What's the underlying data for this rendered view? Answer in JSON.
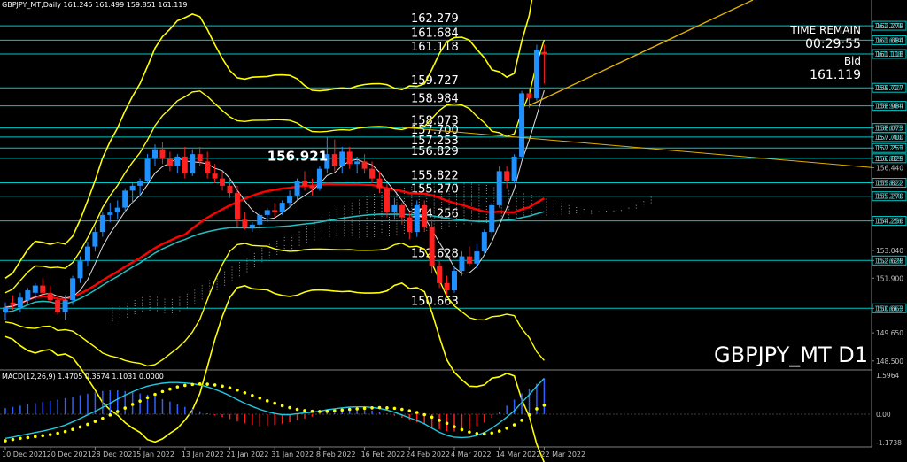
{
  "header": {
    "title": "GBPJPY_MT,Daily  161.245 161.499 159.851 161.119"
  },
  "watermark": "GBPJPY_MT D1",
  "info": {
    "time_remain_label": "TIME REMAIN",
    "time_remain": "00:29:55",
    "bid_label": "Bid",
    "bid": "161.119"
  },
  "macd": {
    "label": "MACD(12,26,9) 1.4705 0.3674 1.1031 0.0000",
    "ticks": [
      "1.5964",
      "0.00",
      "-1.1738"
    ],
    "range": [
      -1.1738,
      1.5964
    ]
  },
  "colors": {
    "background": "#000000",
    "grid": "#1e1e1e",
    "level_line": "#00c8c8",
    "bull": "#1e90ff",
    "bear": "#ff2020",
    "bollinger": "#ffff00",
    "ma_red": "#ff0000",
    "ma_cyan": "#20c0c0",
    "ma_white": "#e0e0e0",
    "trendline": "#e0b000",
    "macd_hist_pos": "#3060ff",
    "macd_hist_neg": "#ff2020",
    "macd_main": "#20c8e0",
    "macd_signal": "#ffff00",
    "axis_text": "#c0c0c0",
    "level_label": "#ffffff"
  },
  "chart_data": {
    "type": "candlestick",
    "symbol": "GBPJPY_MT",
    "timeframe": "Daily",
    "ylim": [
      148.2,
      162.9
    ],
    "y_ticks": [
      "162.279",
      "161.684",
      "161.118",
      "159.727",
      "158.984",
      "158.073",
      "157.700",
      "157.253",
      "156.829",
      "156.440",
      "155.822",
      "155.270",
      "154.256",
      "153.040",
      "152.628",
      "151.900",
      "150.663",
      "149.650",
      "148.500"
    ],
    "x_ticks": [
      "10 Dec 2021",
      "20 Dec 2021",
      "28 Dec 2021",
      "5 Jan 2022",
      "13 Jan 2022",
      "21 Jan 2022",
      "31 Jan 2022",
      "8 Feb 2022",
      "16 Feb 2022",
      "24 Feb 2022",
      "4 Mar 2022",
      "14 Mar 2022",
      "22 Mar 2022"
    ],
    "levels": [
      {
        "label": "162.279",
        "value": 162.279
      },
      {
        "label": "161.684",
        "value": 161.684
      },
      {
        "label": "161.118",
        "value": 161.118
      },
      {
        "label": "159.727",
        "value": 159.727
      },
      {
        "label": "158.984",
        "value": 158.984
      },
      {
        "label": "158.073",
        "value": 158.073
      },
      {
        "label": "157.700",
        "value": 157.7
      },
      {
        "label": "157.253",
        "value": 157.253
      },
      {
        "label": "156.829",
        "value": 156.829
      },
      {
        "label": "155.822",
        "value": 155.822
      },
      {
        "label": "155.270",
        "value": 155.27
      },
      {
        "label": "154.256",
        "value": 154.256
      },
      {
        "label": "152.628",
        "value": 152.628
      },
      {
        "label": "150.663",
        "value": 150.663
      }
    ],
    "annotation": {
      "label": "156.921",
      "value": 156.921,
      "bar": 35
    },
    "candles": [
      {
        "o": 150.5,
        "h": 150.9,
        "l": 150.2,
        "c": 150.7
      },
      {
        "o": 150.9,
        "h": 151.2,
        "l": 150.6,
        "c": 150.8
      },
      {
        "o": 150.7,
        "h": 151.3,
        "l": 150.5,
        "c": 151.1
      },
      {
        "o": 151.0,
        "h": 151.5,
        "l": 150.8,
        "c": 151.4
      },
      {
        "o": 151.3,
        "h": 151.7,
        "l": 151.0,
        "c": 151.6
      },
      {
        "o": 151.6,
        "h": 151.9,
        "l": 151.2,
        "c": 151.3
      },
      {
        "o": 151.3,
        "h": 151.6,
        "l": 150.9,
        "c": 151.0
      },
      {
        "o": 151.0,
        "h": 151.2,
        "l": 150.4,
        "c": 150.5
      },
      {
        "o": 150.5,
        "h": 151.2,
        "l": 150.2,
        "c": 151.0
      },
      {
        "o": 151.0,
        "h": 152.0,
        "l": 150.8,
        "c": 151.9
      },
      {
        "o": 151.9,
        "h": 152.8,
        "l": 151.7,
        "c": 152.6
      },
      {
        "o": 152.6,
        "h": 153.4,
        "l": 152.4,
        "c": 153.2
      },
      {
        "o": 153.2,
        "h": 154.0,
        "l": 153.0,
        "c": 153.8
      },
      {
        "o": 153.8,
        "h": 154.6,
        "l": 153.6,
        "c": 154.5
      },
      {
        "o": 154.5,
        "h": 155.0,
        "l": 154.2,
        "c": 154.6
      },
      {
        "o": 154.6,
        "h": 155.1,
        "l": 154.3,
        "c": 154.8
      },
      {
        "o": 154.8,
        "h": 155.6,
        "l": 154.6,
        "c": 155.5
      },
      {
        "o": 155.5,
        "h": 155.8,
        "l": 155.0,
        "c": 155.7
      },
      {
        "o": 155.7,
        "h": 156.0,
        "l": 155.3,
        "c": 155.9
      },
      {
        "o": 155.9,
        "h": 157.0,
        "l": 155.8,
        "c": 156.8
      },
      {
        "o": 156.8,
        "h": 157.4,
        "l": 156.5,
        "c": 157.2
      },
      {
        "o": 157.2,
        "h": 157.5,
        "l": 156.6,
        "c": 156.8
      },
      {
        "o": 156.8,
        "h": 157.1,
        "l": 156.3,
        "c": 156.5
      },
      {
        "o": 156.5,
        "h": 157.0,
        "l": 156.2,
        "c": 156.9
      },
      {
        "o": 156.9,
        "h": 157.3,
        "l": 156.0,
        "c": 156.2
      },
      {
        "o": 156.2,
        "h": 157.2,
        "l": 156.1,
        "c": 157.0
      },
      {
        "o": 157.0,
        "h": 157.3,
        "l": 156.5,
        "c": 156.7
      },
      {
        "o": 156.7,
        "h": 157.1,
        "l": 156.0,
        "c": 156.2
      },
      {
        "o": 156.2,
        "h": 156.6,
        "l": 155.8,
        "c": 156.0
      },
      {
        "o": 156.0,
        "h": 156.3,
        "l": 155.5,
        "c": 155.7
      },
      {
        "o": 155.7,
        "h": 156.0,
        "l": 155.2,
        "c": 155.4
      },
      {
        "o": 155.4,
        "h": 155.7,
        "l": 154.0,
        "c": 154.3
      },
      {
        "o": 154.3,
        "h": 154.6,
        "l": 153.9,
        "c": 154.0
      },
      {
        "o": 154.0,
        "h": 154.2,
        "l": 153.8,
        "c": 154.1
      },
      {
        "o": 154.1,
        "h": 154.6,
        "l": 153.9,
        "c": 154.5
      },
      {
        "o": 154.5,
        "h": 154.8,
        "l": 154.2,
        "c": 154.7
      },
      {
        "o": 154.7,
        "h": 155.0,
        "l": 154.4,
        "c": 154.6
      },
      {
        "o": 154.6,
        "h": 155.1,
        "l": 154.5,
        "c": 155.0
      },
      {
        "o": 155.0,
        "h": 155.5,
        "l": 154.8,
        "c": 155.3
      },
      {
        "o": 155.3,
        "h": 156.0,
        "l": 155.1,
        "c": 155.9
      },
      {
        "o": 155.9,
        "h": 156.3,
        "l": 155.5,
        "c": 155.7
      },
      {
        "o": 155.7,
        "h": 156.0,
        "l": 155.3,
        "c": 155.6
      },
      {
        "o": 155.6,
        "h": 156.5,
        "l": 155.5,
        "c": 156.4
      },
      {
        "o": 156.4,
        "h": 157.7,
        "l": 156.2,
        "c": 157.0
      },
      {
        "o": 157.0,
        "h": 157.6,
        "l": 156.3,
        "c": 156.5
      },
      {
        "o": 156.5,
        "h": 157.3,
        "l": 156.2,
        "c": 157.1
      },
      {
        "o": 157.1,
        "h": 157.3,
        "l": 156.4,
        "c": 156.6
      },
      {
        "o": 156.6,
        "h": 156.9,
        "l": 156.2,
        "c": 156.7
      },
      {
        "o": 156.7,
        "h": 157.0,
        "l": 156.2,
        "c": 156.4
      },
      {
        "o": 156.4,
        "h": 156.7,
        "l": 155.8,
        "c": 156.0
      },
      {
        "o": 156.0,
        "h": 156.3,
        "l": 155.4,
        "c": 155.6
      },
      {
        "o": 155.6,
        "h": 155.8,
        "l": 154.4,
        "c": 154.6
      },
      {
        "o": 154.6,
        "h": 155.2,
        "l": 154.3,
        "c": 154.9
      },
      {
        "o": 154.9,
        "h": 155.0,
        "l": 154.1,
        "c": 154.4
      },
      {
        "o": 154.4,
        "h": 154.6,
        "l": 153.5,
        "c": 153.8
      },
      {
        "o": 153.8,
        "h": 155.1,
        "l": 153.6,
        "c": 154.9
      },
      {
        "o": 154.9,
        "h": 155.1,
        "l": 153.8,
        "c": 154.0
      },
      {
        "o": 154.0,
        "h": 154.3,
        "l": 152.1,
        "c": 152.4
      },
      {
        "o": 152.4,
        "h": 152.6,
        "l": 151.5,
        "c": 151.7
      },
      {
        "o": 151.7,
        "h": 152.0,
        "l": 151.2,
        "c": 151.4
      },
      {
        "o": 151.4,
        "h": 152.4,
        "l": 151.3,
        "c": 152.2
      },
      {
        "o": 152.2,
        "h": 153.0,
        "l": 152.0,
        "c": 152.8
      },
      {
        "o": 152.8,
        "h": 153.2,
        "l": 152.4,
        "c": 152.5
      },
      {
        "o": 152.5,
        "h": 153.3,
        "l": 152.3,
        "c": 153.0
      },
      {
        "o": 153.0,
        "h": 153.9,
        "l": 152.9,
        "c": 153.8
      },
      {
        "o": 153.8,
        "h": 155.0,
        "l": 153.6,
        "c": 154.9
      },
      {
        "o": 154.9,
        "h": 156.5,
        "l": 154.8,
        "c": 156.3
      },
      {
        "o": 156.3,
        "h": 156.5,
        "l": 155.6,
        "c": 155.9
      },
      {
        "o": 155.9,
        "h": 157.0,
        "l": 155.8,
        "c": 156.9
      },
      {
        "o": 156.9,
        "h": 159.6,
        "l": 156.8,
        "c": 159.5
      },
      {
        "o": 159.5,
        "h": 159.7,
        "l": 158.9,
        "c": 159.3
      },
      {
        "o": 159.3,
        "h": 161.5,
        "l": 159.2,
        "c": 161.3
      },
      {
        "o": 161.2,
        "h": 161.5,
        "l": 159.9,
        "c": 161.1
      }
    ],
    "macd": [
      {
        "hist": 0.25,
        "main": -1.0,
        "signal": -1.1
      },
      {
        "hist": 0.3,
        "main": -0.95,
        "signal": -1.05
      },
      {
        "hist": 0.35,
        "main": -0.88,
        "signal": -1.0
      },
      {
        "hist": 0.4,
        "main": -0.82,
        "signal": -0.97
      },
      {
        "hist": 0.45,
        "main": -0.76,
        "signal": -0.93
      },
      {
        "hist": 0.5,
        "main": -0.7,
        "signal": -0.89
      },
      {
        "hist": 0.55,
        "main": -0.63,
        "signal": -0.85
      },
      {
        "hist": 0.6,
        "main": -0.55,
        "signal": -0.79
      },
      {
        "hist": 0.66,
        "main": -0.45,
        "signal": -0.72
      },
      {
        "hist": 0.72,
        "main": -0.32,
        "signal": -0.63
      },
      {
        "hist": 0.78,
        "main": -0.18,
        "signal": -0.53
      },
      {
        "hist": 0.84,
        "main": -0.03,
        "signal": -0.42
      },
      {
        "hist": 0.9,
        "main": 0.12,
        "signal": -0.3
      },
      {
        "hist": 0.95,
        "main": 0.28,
        "signal": -0.17
      },
      {
        "hist": 0.98,
        "main": 0.45,
        "signal": -0.03
      },
      {
        "hist": 0.98,
        "main": 0.62,
        "signal": 0.11
      },
      {
        "hist": 0.95,
        "main": 0.78,
        "signal": 0.25
      },
      {
        "hist": 0.9,
        "main": 0.92,
        "signal": 0.4
      },
      {
        "hist": 0.85,
        "main": 1.05,
        "signal": 0.54
      },
      {
        "hist": 0.8,
        "main": 1.15,
        "signal": 0.68
      },
      {
        "hist": 0.72,
        "main": 1.22,
        "signal": 0.81
      },
      {
        "hist": 0.62,
        "main": 1.27,
        "signal": 0.93
      },
      {
        "hist": 0.52,
        "main": 1.3,
        "signal": 1.03
      },
      {
        "hist": 0.4,
        "main": 1.3,
        "signal": 1.12
      },
      {
        "hist": 0.3,
        "main": 1.28,
        "signal": 1.18
      },
      {
        "hist": 0.22,
        "main": 1.25,
        "signal": 1.22
      },
      {
        "hist": 0.12,
        "main": 1.2,
        "signal": 1.24
      },
      {
        "hist": 0.04,
        "main": 1.12,
        "signal": 1.23
      },
      {
        "hist": -0.05,
        "main": 1.02,
        "signal": 1.2
      },
      {
        "hist": -0.12,
        "main": 0.9,
        "signal": 1.15
      },
      {
        "hist": -0.2,
        "main": 0.76,
        "signal": 1.08
      },
      {
        "hist": -0.3,
        "main": 0.6,
        "signal": 0.99
      },
      {
        "hist": -0.38,
        "main": 0.45,
        "signal": 0.88
      },
      {
        "hist": -0.45,
        "main": 0.32,
        "signal": 0.77
      },
      {
        "hist": -0.5,
        "main": 0.2,
        "signal": 0.66
      },
      {
        "hist": -0.48,
        "main": 0.1,
        "signal": 0.55
      },
      {
        "hist": -0.45,
        "main": 0.03,
        "signal": 0.45
      },
      {
        "hist": -0.4,
        "main": -0.02,
        "signal": 0.35
      },
      {
        "hist": -0.33,
        "main": -0.02,
        "signal": 0.27
      },
      {
        "hist": -0.25,
        "main": 0.02,
        "signal": 0.2
      },
      {
        "hist": -0.18,
        "main": 0.05,
        "signal": 0.15
      },
      {
        "hist": -0.1,
        "main": 0.08,
        "signal": 0.12
      },
      {
        "hist": 0.03,
        "main": 0.12,
        "signal": 0.11
      },
      {
        "hist": 0.1,
        "main": 0.18,
        "signal": 0.12
      },
      {
        "hist": 0.16,
        "main": 0.22,
        "signal": 0.14
      },
      {
        "hist": 0.18,
        "main": 0.26,
        "signal": 0.17
      },
      {
        "hist": 0.2,
        "main": 0.29,
        "signal": 0.2
      },
      {
        "hist": 0.2,
        "main": 0.3,
        "signal": 0.22
      },
      {
        "hist": 0.18,
        "main": 0.3,
        "signal": 0.24
      },
      {
        "hist": 0.15,
        "main": 0.28,
        "signal": 0.26
      },
      {
        "hist": 0.1,
        "main": 0.24,
        "signal": 0.27
      },
      {
        "hist": 0.03,
        "main": 0.17,
        "signal": 0.26
      },
      {
        "hist": -0.06,
        "main": 0.08,
        "signal": 0.24
      },
      {
        "hist": -0.15,
        "main": -0.03,
        "signal": 0.2
      },
      {
        "hist": -0.25,
        "main": -0.15,
        "signal": 0.14
      },
      {
        "hist": -0.33,
        "main": -0.26,
        "signal": 0.07
      },
      {
        "hist": -0.42,
        "main": -0.4,
        "signal": -0.02
      },
      {
        "hist": -0.52,
        "main": -0.58,
        "signal": -0.12
      },
      {
        "hist": -0.62,
        "main": -0.75,
        "signal": -0.25
      },
      {
        "hist": -0.7,
        "main": -0.88,
        "signal": -0.38
      },
      {
        "hist": -0.72,
        "main": -0.95,
        "signal": -0.52
      },
      {
        "hist": -0.7,
        "main": -0.97,
        "signal": -0.64
      },
      {
        "hist": -0.62,
        "main": -0.95,
        "signal": -0.74
      },
      {
        "hist": -0.5,
        "main": -0.88,
        "signal": -0.8
      },
      {
        "hist": -0.35,
        "main": -0.76,
        "signal": -0.82
      },
      {
        "hist": -0.15,
        "main": -0.58,
        "signal": -0.78
      },
      {
        "hist": 0.1,
        "main": -0.36,
        "signal": -0.7
      },
      {
        "hist": 0.35,
        "main": -0.12,
        "signal": -0.58
      },
      {
        "hist": 0.6,
        "main": 0.14,
        "signal": -0.44
      },
      {
        "hist": 0.85,
        "main": 0.48,
        "signal": -0.25
      },
      {
        "hist": 1.05,
        "main": 0.8,
        "signal": -0.03
      },
      {
        "hist": 1.25,
        "main": 1.15,
        "signal": 0.22
      },
      {
        "hist": 1.47,
        "main": 1.47,
        "signal": 0.37
      }
    ]
  }
}
